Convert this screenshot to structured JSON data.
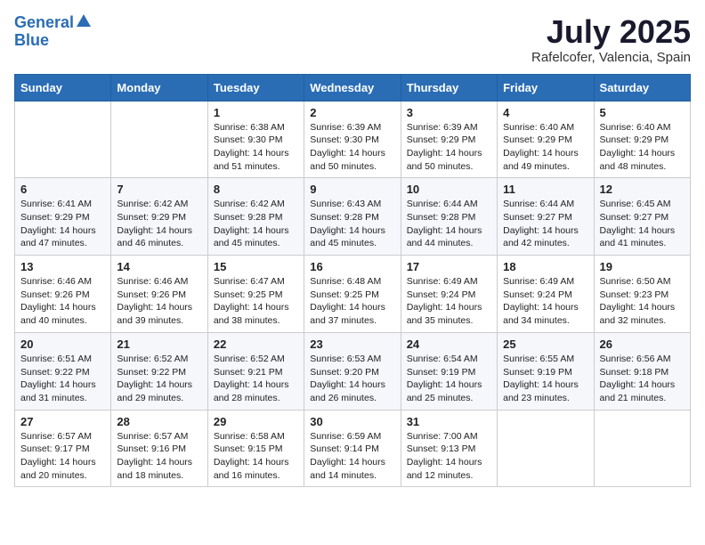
{
  "header": {
    "logo_line1": "General",
    "logo_line2": "Blue",
    "month": "July 2025",
    "location": "Rafelcofer, Valencia, Spain"
  },
  "weekdays": [
    "Sunday",
    "Monday",
    "Tuesday",
    "Wednesday",
    "Thursday",
    "Friday",
    "Saturday"
  ],
  "weeks": [
    [
      {
        "day": "",
        "text": ""
      },
      {
        "day": "",
        "text": ""
      },
      {
        "day": "1",
        "text": "Sunrise: 6:38 AM\nSunset: 9:30 PM\nDaylight: 14 hours and 51 minutes."
      },
      {
        "day": "2",
        "text": "Sunrise: 6:39 AM\nSunset: 9:30 PM\nDaylight: 14 hours and 50 minutes."
      },
      {
        "day": "3",
        "text": "Sunrise: 6:39 AM\nSunset: 9:29 PM\nDaylight: 14 hours and 50 minutes."
      },
      {
        "day": "4",
        "text": "Sunrise: 6:40 AM\nSunset: 9:29 PM\nDaylight: 14 hours and 49 minutes."
      },
      {
        "day": "5",
        "text": "Sunrise: 6:40 AM\nSunset: 9:29 PM\nDaylight: 14 hours and 48 minutes."
      }
    ],
    [
      {
        "day": "6",
        "text": "Sunrise: 6:41 AM\nSunset: 9:29 PM\nDaylight: 14 hours and 47 minutes."
      },
      {
        "day": "7",
        "text": "Sunrise: 6:42 AM\nSunset: 9:29 PM\nDaylight: 14 hours and 46 minutes."
      },
      {
        "day": "8",
        "text": "Sunrise: 6:42 AM\nSunset: 9:28 PM\nDaylight: 14 hours and 45 minutes."
      },
      {
        "day": "9",
        "text": "Sunrise: 6:43 AM\nSunset: 9:28 PM\nDaylight: 14 hours and 45 minutes."
      },
      {
        "day": "10",
        "text": "Sunrise: 6:44 AM\nSunset: 9:28 PM\nDaylight: 14 hours and 44 minutes."
      },
      {
        "day": "11",
        "text": "Sunrise: 6:44 AM\nSunset: 9:27 PM\nDaylight: 14 hours and 42 minutes."
      },
      {
        "day": "12",
        "text": "Sunrise: 6:45 AM\nSunset: 9:27 PM\nDaylight: 14 hours and 41 minutes."
      }
    ],
    [
      {
        "day": "13",
        "text": "Sunrise: 6:46 AM\nSunset: 9:26 PM\nDaylight: 14 hours and 40 minutes."
      },
      {
        "day": "14",
        "text": "Sunrise: 6:46 AM\nSunset: 9:26 PM\nDaylight: 14 hours and 39 minutes."
      },
      {
        "day": "15",
        "text": "Sunrise: 6:47 AM\nSunset: 9:25 PM\nDaylight: 14 hours and 38 minutes."
      },
      {
        "day": "16",
        "text": "Sunrise: 6:48 AM\nSunset: 9:25 PM\nDaylight: 14 hours and 37 minutes."
      },
      {
        "day": "17",
        "text": "Sunrise: 6:49 AM\nSunset: 9:24 PM\nDaylight: 14 hours and 35 minutes."
      },
      {
        "day": "18",
        "text": "Sunrise: 6:49 AM\nSunset: 9:24 PM\nDaylight: 14 hours and 34 minutes."
      },
      {
        "day": "19",
        "text": "Sunrise: 6:50 AM\nSunset: 9:23 PM\nDaylight: 14 hours and 32 minutes."
      }
    ],
    [
      {
        "day": "20",
        "text": "Sunrise: 6:51 AM\nSunset: 9:22 PM\nDaylight: 14 hours and 31 minutes."
      },
      {
        "day": "21",
        "text": "Sunrise: 6:52 AM\nSunset: 9:22 PM\nDaylight: 14 hours and 29 minutes."
      },
      {
        "day": "22",
        "text": "Sunrise: 6:52 AM\nSunset: 9:21 PM\nDaylight: 14 hours and 28 minutes."
      },
      {
        "day": "23",
        "text": "Sunrise: 6:53 AM\nSunset: 9:20 PM\nDaylight: 14 hours and 26 minutes."
      },
      {
        "day": "24",
        "text": "Sunrise: 6:54 AM\nSunset: 9:19 PM\nDaylight: 14 hours and 25 minutes."
      },
      {
        "day": "25",
        "text": "Sunrise: 6:55 AM\nSunset: 9:19 PM\nDaylight: 14 hours and 23 minutes."
      },
      {
        "day": "26",
        "text": "Sunrise: 6:56 AM\nSunset: 9:18 PM\nDaylight: 14 hours and 21 minutes."
      }
    ],
    [
      {
        "day": "27",
        "text": "Sunrise: 6:57 AM\nSunset: 9:17 PM\nDaylight: 14 hours and 20 minutes."
      },
      {
        "day": "28",
        "text": "Sunrise: 6:57 AM\nSunset: 9:16 PM\nDaylight: 14 hours and 18 minutes."
      },
      {
        "day": "29",
        "text": "Sunrise: 6:58 AM\nSunset: 9:15 PM\nDaylight: 14 hours and 16 minutes."
      },
      {
        "day": "30",
        "text": "Sunrise: 6:59 AM\nSunset: 9:14 PM\nDaylight: 14 hours and 14 minutes."
      },
      {
        "day": "31",
        "text": "Sunrise: 7:00 AM\nSunset: 9:13 PM\nDaylight: 14 hours and 12 minutes."
      },
      {
        "day": "",
        "text": ""
      },
      {
        "day": "",
        "text": ""
      }
    ]
  ]
}
